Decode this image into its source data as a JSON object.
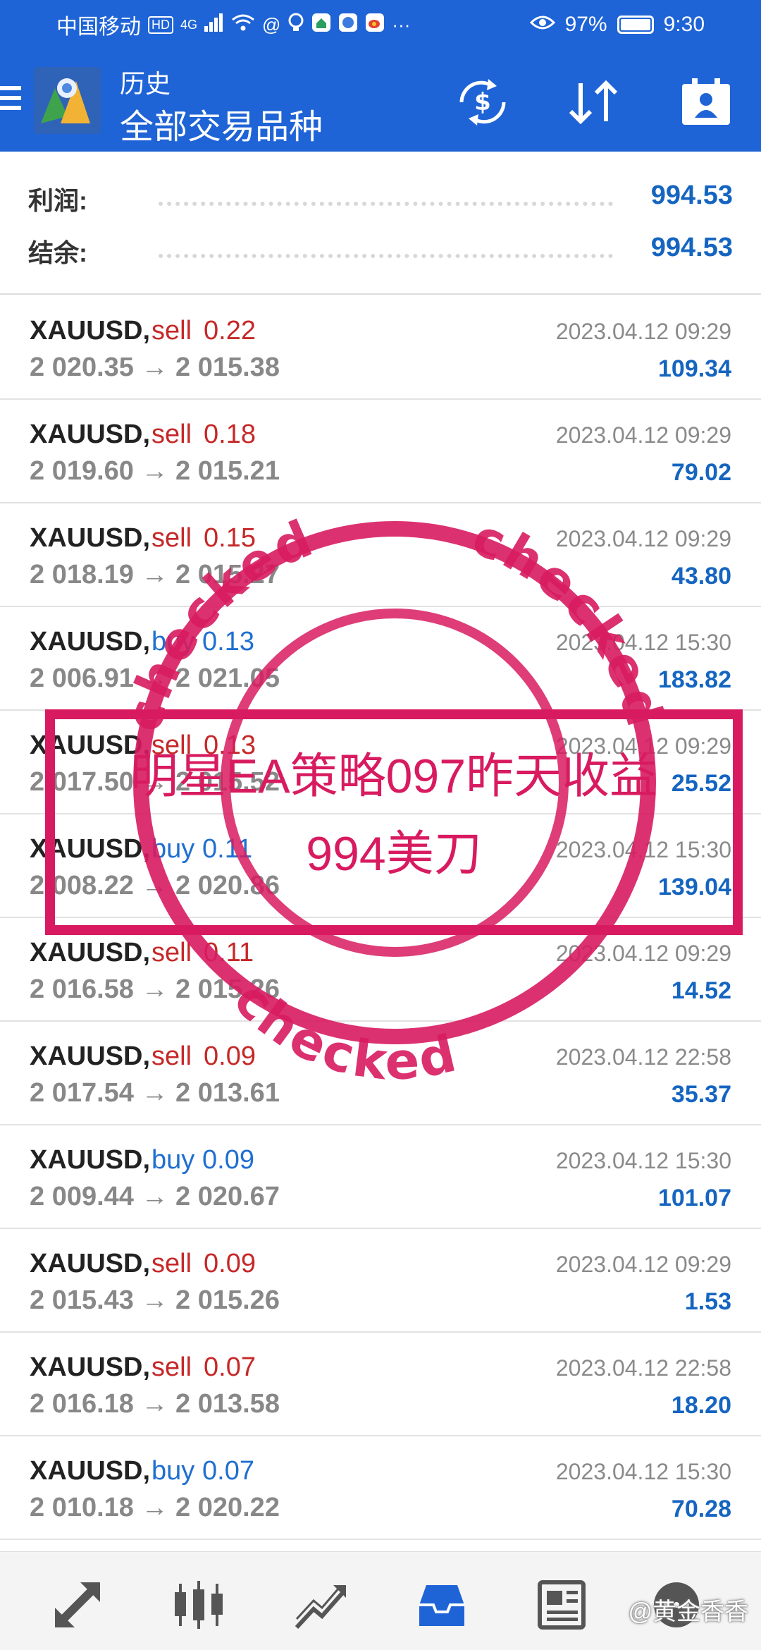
{
  "status_bar": {
    "carrier": "中国移动",
    "hd": "HD",
    "network": "4G",
    "battery": "97%",
    "time": "9:30"
  },
  "app_bar": {
    "title_top": "历史",
    "title_main": "全部交易品种"
  },
  "summary": {
    "profit_label": "利润:",
    "profit_value": "994.53",
    "balance_label": "结余:",
    "balance_value": "994.53"
  },
  "trades": [
    {
      "symbol": "XAUUSD,",
      "side": "sell",
      "volume": "0.22",
      "prices": "2 020.35 → 2 015.38",
      "time": "2023.04.12 09:29",
      "profit": "109.34"
    },
    {
      "symbol": "XAUUSD,",
      "side": "sell",
      "volume": "0.18",
      "prices": "2 019.60 → 2 015.21",
      "time": "2023.04.12 09:29",
      "profit": "79.02"
    },
    {
      "symbol": "XAUUSD,",
      "side": "sell",
      "volume": "0.15",
      "prices": "2 018.19 → 2 015.27",
      "time": "2023.04.12 09:29",
      "profit": "43.80"
    },
    {
      "symbol": "XAUUSD,",
      "side": "buy",
      "volume": "0.13",
      "prices": "2 006.91 → 2 021.05",
      "time": "2023.04.12 15:30",
      "profit": "183.82"
    },
    {
      "symbol": "XAUUSD,",
      "side": "sell",
      "volume": "0.13",
      "prices": "2 017.50 → 2 015.52",
      "time": "2023.04.12 09:29",
      "profit": "25.52"
    },
    {
      "symbol": "XAUUSD,",
      "side": "buy",
      "volume": "0.11",
      "prices": "2 008.22 → 2 020.86",
      "time": "2023.04.12 15:30",
      "profit": "139.04"
    },
    {
      "symbol": "XAUUSD,",
      "side": "sell",
      "volume": "0.11",
      "prices": "2 016.58 → 2 015.26",
      "time": "2023.04.12 09:29",
      "profit": "14.52"
    },
    {
      "symbol": "XAUUSD,",
      "side": "sell",
      "volume": "0.09",
      "prices": "2 017.54 → 2 013.61",
      "time": "2023.04.12 22:58",
      "profit": "35.37"
    },
    {
      "symbol": "XAUUSD,",
      "side": "buy",
      "volume": "0.09",
      "prices": "2 009.44 → 2 020.67",
      "time": "2023.04.12 15:30",
      "profit": "101.07"
    },
    {
      "symbol": "XAUUSD,",
      "side": "sell",
      "volume": "0.09",
      "prices": "2 015.43 → 2 015.26",
      "time": "2023.04.12 09:29",
      "profit": "1.53"
    },
    {
      "symbol": "XAUUSD,",
      "side": "sell",
      "volume": "0.07",
      "prices": "2 016.18 → 2 013.58",
      "time": "2023.04.12 22:58",
      "profit": "18.20"
    },
    {
      "symbol": "XAUUSD,",
      "side": "buy",
      "volume": "0.07",
      "prices": "2 010.18 → 2 020.22",
      "time": "2023.04.12 15:30",
      "profit": "70.28"
    }
  ],
  "stamp": {
    "line1": "明星EA策略097昨天收益",
    "line2": "994美刀",
    "seal_word": "checked"
  },
  "watermark": "@黄金香香",
  "colors": {
    "primary": "#1f64d6",
    "sell": "#c62828",
    "buy": "#1f6fd0",
    "profit": "#1565c0",
    "stamp": "#d81b60"
  },
  "icons": {
    "menu": "menu-icon",
    "app_logo": "metatrader-logo-icon",
    "currency": "currency-exchange-icon",
    "sort": "sort-icon",
    "account": "account-icon",
    "nav": [
      "quotes-icon",
      "chart-icon",
      "trade-icon",
      "history-icon",
      "news-icon",
      "chat-icon"
    ]
  }
}
